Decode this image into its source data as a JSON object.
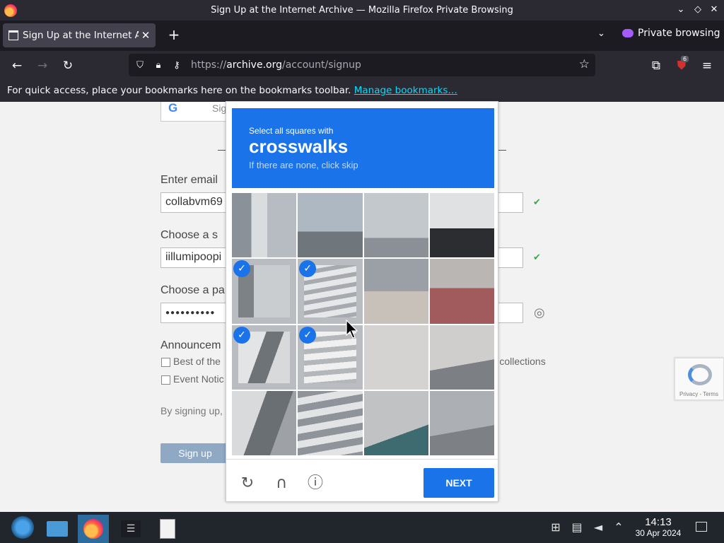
{
  "window": {
    "title": "Sign Up at the Internet Archive — Mozilla Firefox Private Browsing"
  },
  "tabs": [
    {
      "label": "Sign Up at the Internet Ar",
      "close": "✕"
    }
  ],
  "toolbar": {
    "new_tab": "+",
    "private_label": "Private browsing",
    "extension_badge": "6"
  },
  "urlbar": {
    "scheme": "https://",
    "host": "archive.org",
    "path": "/account/signup"
  },
  "bookmarks_bar": {
    "message": "For quick access, place your bookmarks here on the bookmarks toolbar.",
    "link": "Manage bookmarks…"
  },
  "signup_form": {
    "google_button": "Sig",
    "email_label": "Enter email",
    "email_value": "collabvm69",
    "screenname_label": "Choose a s",
    "screenname_value": "iillumipoopi",
    "password_label": "Choose a pa",
    "password_value": "●●●●●●●●●●",
    "announcements_label": "Announcem",
    "option_1": "Best of the",
    "option_1_tail": "ur collections",
    "option_2": "Event Notic",
    "terms_text": "By signing up, y",
    "signup_button": "Sign up"
  },
  "captcha": {
    "instruction": "Select all squares with",
    "target": "crosswalks",
    "hint": "If there are none, click skip",
    "selected_tiles": [
      4,
      5,
      8,
      9
    ],
    "next_button": "NEXT",
    "badge_text": "Privacy - Terms"
  },
  "taskbar": {
    "time": "14:13",
    "date": "30 Apr 2024"
  }
}
